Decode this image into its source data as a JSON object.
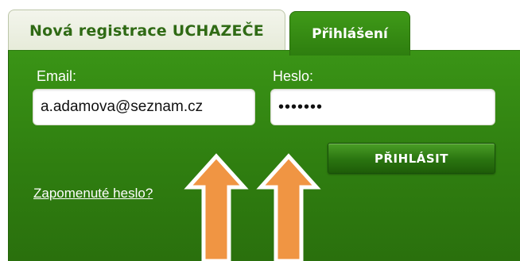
{
  "tabs": {
    "register_label": "Nová registrace UCHAZEČE",
    "login_label": "Přihlášení"
  },
  "form": {
    "email_label": "Email:",
    "email_value": "a.adamova@seznam.cz",
    "password_label": "Heslo:",
    "password_value": "•••••••",
    "login_button_label": "PŘIHLÁSIT",
    "forgot_link_label": "Zapomenuté heslo?"
  },
  "colors": {
    "panel_green": "#2f7e10",
    "tab_text_green": "#2f6a14",
    "arrow_orange": "#f09543"
  },
  "annotations": {
    "arrow_icon": "up-arrow-icon"
  }
}
